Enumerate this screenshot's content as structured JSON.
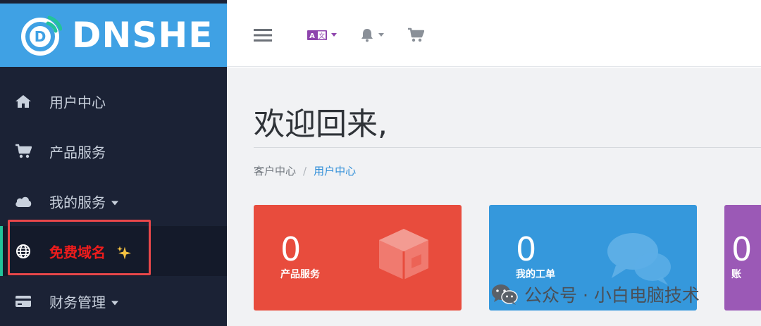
{
  "brand": {
    "name": "DNSHE"
  },
  "sidebar": {
    "items": [
      {
        "label": "用户中心",
        "icon": "home-icon"
      },
      {
        "label": "产品服务",
        "icon": "cart-icon"
      },
      {
        "label": "我的服务",
        "icon": "cloud-icon",
        "dropdown": true
      },
      {
        "label": "免费域名",
        "icon": "globe-icon",
        "badge_icon": "sparkles-icon",
        "active": true
      },
      {
        "label": "财务管理",
        "icon": "credit-card-icon",
        "dropdown": true
      }
    ]
  },
  "topbar": {
    "icons": [
      "menu-icon",
      "language-icon",
      "bell-icon",
      "cart-icon"
    ]
  },
  "main": {
    "welcome": "欢迎回来,",
    "breadcrumb": {
      "root": "客户中心",
      "separator": "/",
      "current": "用户中心"
    },
    "cards": [
      {
        "value": "0",
        "label": "产品服务",
        "color": "#e84c3d"
      },
      {
        "value": "0",
        "label": "我的工单",
        "color": "#3598dc"
      },
      {
        "value": "0",
        "label": "账",
        "color": "#9b59b6"
      }
    ]
  },
  "watermark": {
    "text": "公众号 · 小白电脑技术"
  },
  "colors": {
    "sidebar_bg": "#1b2235",
    "logo_bg": "#3fa1e4",
    "accent_green": "#22c39a",
    "active_text": "#f01c1c",
    "highlight_border": "#e8474a"
  }
}
